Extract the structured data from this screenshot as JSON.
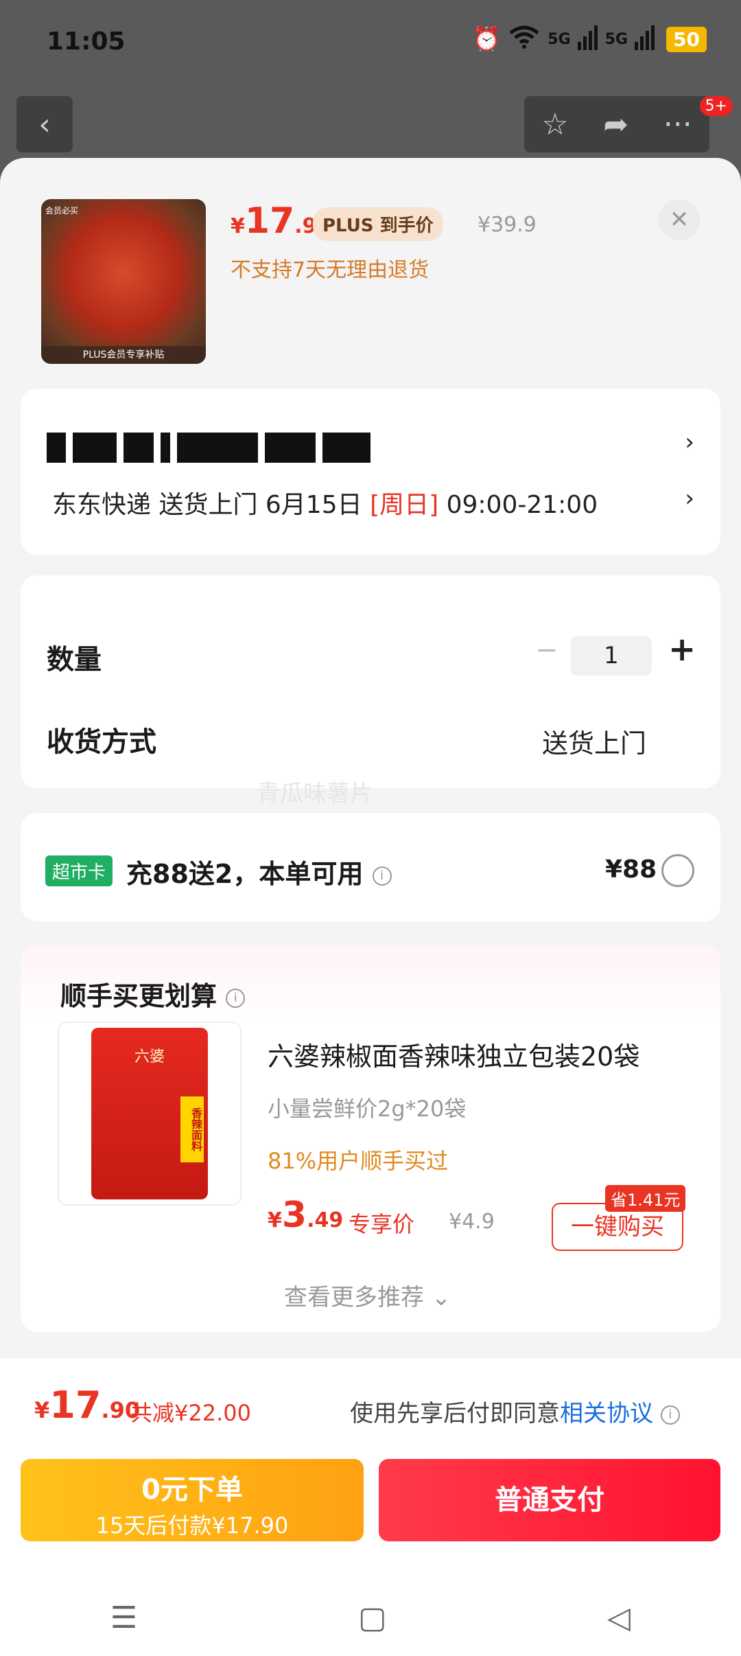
{
  "status_bar": {
    "time": "11:05",
    "battery": "50",
    "signal1": "5G",
    "signal2": "5G"
  },
  "header": {
    "notification_count": "5+"
  },
  "product": {
    "currency": "¥",
    "price_int": "17",
    "price_dec": ".9",
    "plus_label": "PLUS 到手价",
    "original_price": "¥39.9",
    "return_policy": "不支持7天无理由退货",
    "image_tag": "PLUS会员专享补贴",
    "image_mark": "会员必买"
  },
  "delivery": {
    "carrier_method": "东东快递 送货上门 6月15日",
    "day": "[周日]",
    "time_window": "09:00-21:00"
  },
  "order_options": {
    "quantity_label": "数量",
    "quantity_value": "1",
    "shipping_label": "收货方式",
    "shipping_value": "送货上门"
  },
  "watermark": "青瓜味薯片",
  "supermarket_card": {
    "tag": "超市卡",
    "text": "充88送2，本单可用",
    "amount": "¥88"
  },
  "recommendation": {
    "title": "顺手买更划算",
    "product_name": "六婆辣椒面香辣味独立包装20袋",
    "subtitle": "小量尝鲜价2g*20袋",
    "buyers": "81%用户顺手买过",
    "currency": "¥",
    "price_int": "3",
    "price_dec": ".49",
    "exclusive": "专享价",
    "original_price": "¥4.9",
    "save_tag": "省1.41元",
    "buy_button": "一键购买",
    "more": "查看更多推荐 ⌄",
    "pack_brand": "六婆",
    "pack_side": "香辣面料"
  },
  "footer": {
    "currency": "¥",
    "total_int": "17",
    "total_dec": ".90",
    "reduced": "共减¥22.00",
    "agreement_prefix": "使用先享后付即同意",
    "agreement_link": "相关协议",
    "pay_later_title": "0元下单",
    "pay_later_sub": "15天后付款¥17.90",
    "pay_normal": "普通支付"
  }
}
